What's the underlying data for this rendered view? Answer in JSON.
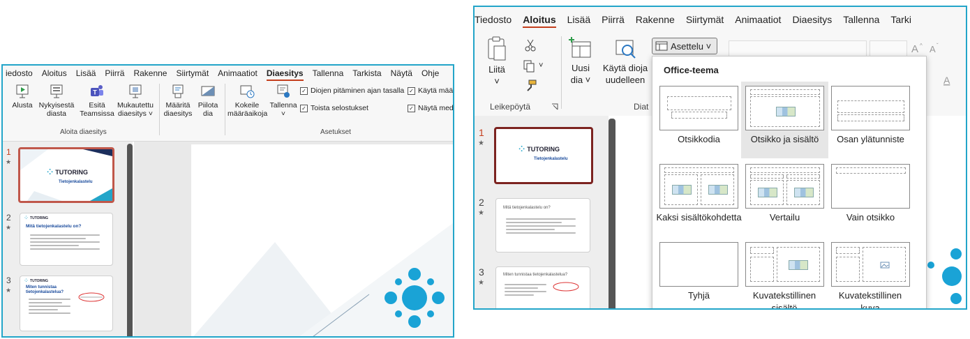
{
  "left": {
    "tabs": [
      {
        "label": "iedosto",
        "active": false
      },
      {
        "label": "Aloitus",
        "active": false
      },
      {
        "label": "Lisää",
        "active": false
      },
      {
        "label": "Piirrä",
        "active": false
      },
      {
        "label": "Rakenne",
        "active": false
      },
      {
        "label": "Siirtymät",
        "active": false
      },
      {
        "label": "Animaatiot",
        "active": false
      },
      {
        "label": "Diaesitys",
        "active": true
      },
      {
        "label": "Tallenna",
        "active": false
      },
      {
        "label": "Tarkista",
        "active": false
      },
      {
        "label": "Näytä",
        "active": false
      },
      {
        "label": "Ohje",
        "active": false
      }
    ],
    "ribbon": {
      "alusta": "Alusta",
      "nykyisesta_1": "Nykyisestä",
      "nykyisesta_2": "diasta",
      "esita_1": "Esitä",
      "esita_2": "Teamsissa",
      "mukautettu_1": "Mukautettu",
      "mukautettu_2": "diaesitys ˅",
      "group_aloita": "Aloita diaesitys",
      "maarita_1": "Määritä",
      "maarita_2": "diaesitys",
      "piilota_1": "Piilota",
      "piilota_2": "dia",
      "kokeile_1": "Kokeile",
      "kokeile_2": "määräaikoja",
      "tallenna_1": "Tallenna",
      "tallenna_2": "˅",
      "chk1": "Diojen pitäminen ajan tasalla",
      "chk2": "Toista selostukset",
      "chk3": "Käytä määr",
      "chk4": "Näytä med",
      "group_asetukset": "Asetukset"
    },
    "slides": [
      {
        "num": "1",
        "star": "★",
        "logo": "TUTORING",
        "title": "Tietojenkalastelu"
      },
      {
        "num": "2",
        "star": "★",
        "logo": "TUTORING",
        "title": "Mitä tietojenkalastelu on?"
      },
      {
        "num": "3",
        "star": "★",
        "logo": "TUTORING",
        "title": "Miten tunnistaa tietojenkalastelua?"
      }
    ]
  },
  "right": {
    "tabs": [
      {
        "label": "Tiedosto",
        "active": false
      },
      {
        "label": "Aloitus",
        "active": true
      },
      {
        "label": "Lisää",
        "active": false
      },
      {
        "label": "Piirrä",
        "active": false
      },
      {
        "label": "Rakenne",
        "active": false
      },
      {
        "label": "Siirtymät",
        "active": false
      },
      {
        "label": "Animaatiot",
        "active": false
      },
      {
        "label": "Diaesitys",
        "active": false
      },
      {
        "label": "Tallenna",
        "active": false
      },
      {
        "label": "Tarki",
        "active": false
      }
    ],
    "ribbon": {
      "liita_1": "Liitä",
      "liita_2": "˅",
      "uusi_1": "Uusi",
      "uusi_2": "dia ˅",
      "kayta_1": "Käytä dioja",
      "kayta_2": "uudelleen",
      "asettelu": "Asettelu ˅",
      "group_leikepoyta": "Leikepöytä",
      "group_diat": "Diat"
    },
    "dropdown": {
      "title": "Office-teema",
      "layouts": [
        {
          "label": "Otsikkodia",
          "selected": false
        },
        {
          "label": "Otsikko ja sisältö",
          "selected": true
        },
        {
          "label": "Osan ylätunniste",
          "selected": false
        },
        {
          "label": "Kaksi sisältökohdetta",
          "selected": false
        },
        {
          "label": "Vertailu",
          "selected": false
        },
        {
          "label": "Vain otsikko",
          "selected": false
        },
        {
          "label": "Tyhjä",
          "selected": false
        },
        {
          "label": "Kuvatekstillinen sisältö",
          "selected": false
        },
        {
          "label": "Kuvatekstillinen kuva",
          "selected": false
        }
      ]
    },
    "slides": [
      {
        "num": "1",
        "star": "★",
        "logo": "TUTORING",
        "title": "Tietojenkalastelu"
      },
      {
        "num": "2",
        "star": "★",
        "title": "Mitä tietojenkalastelu on?"
      },
      {
        "num": "3",
        "star": "★",
        "title": "Miten tunnistaa tietojenkalastelua?"
      }
    ]
  },
  "colors": {
    "accent": "#23a5c9",
    "tab_underline": "#c43e1c",
    "selected_slide_border": "#c0574a"
  }
}
